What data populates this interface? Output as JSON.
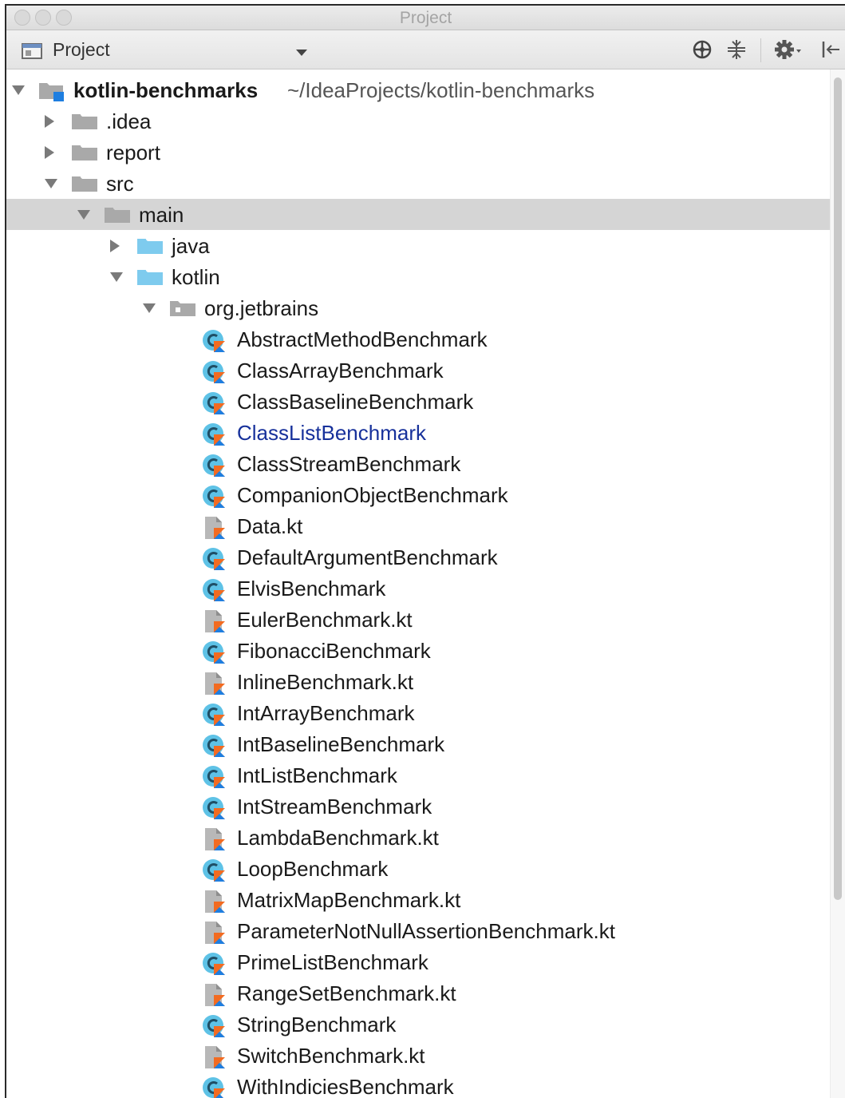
{
  "window": {
    "title": "Project",
    "traffic_lights": [
      "close",
      "minimize",
      "zoom"
    ],
    "light_color": "#d9d9d9"
  },
  "toolbar": {
    "view_label": "Project",
    "view_icon": "project-view-icon",
    "buttons": [
      "locate-icon",
      "collapse-all-icon",
      "settings-gear-icon",
      "hide-panel-icon"
    ]
  },
  "colors": {
    "selection": "#d5d5d5",
    "link": "#17319b",
    "folder_gray": "#a9a9a9",
    "folder_blue": "#7ecbee",
    "kotlin_orange": "#f26b21",
    "kotlin_blue": "#1e7ee0",
    "class_circle": "#5ec2e6"
  },
  "tree": {
    "root": {
      "name": "kotlin-benchmarks",
      "path": "~/IdeaProjects/kotlin-benchmarks"
    },
    "rows": [
      {
        "label": "kotlin-benchmarks",
        "depth": 0,
        "arrow": "down",
        "icon": "module",
        "bold": true,
        "path": "~/IdeaProjects/kotlin-benchmarks"
      },
      {
        "label": ".idea",
        "depth": 1,
        "arrow": "right",
        "icon": "folder"
      },
      {
        "label": "report",
        "depth": 1,
        "arrow": "right",
        "icon": "folder"
      },
      {
        "label": "src",
        "depth": 1,
        "arrow": "down",
        "icon": "folder"
      },
      {
        "label": "main",
        "depth": 2,
        "arrow": "down",
        "icon": "folder",
        "selected": true
      },
      {
        "label": "java",
        "depth": 3,
        "arrow": "right",
        "icon": "source-folder"
      },
      {
        "label": "kotlin",
        "depth": 3,
        "arrow": "down",
        "icon": "source-folder"
      },
      {
        "label": "org.jetbrains",
        "depth": 4,
        "arrow": "down",
        "icon": "package"
      },
      {
        "label": "AbstractMethodBenchmark",
        "depth": 5,
        "icon": "kotlin-class"
      },
      {
        "label": "ClassArrayBenchmark",
        "depth": 5,
        "icon": "kotlin-class"
      },
      {
        "label": "ClassBaselineBenchmark",
        "depth": 5,
        "icon": "kotlin-class"
      },
      {
        "label": "ClassListBenchmark",
        "depth": 5,
        "icon": "kotlin-class",
        "link": true
      },
      {
        "label": "ClassStreamBenchmark",
        "depth": 5,
        "icon": "kotlin-class"
      },
      {
        "label": "CompanionObjectBenchmark",
        "depth": 5,
        "icon": "kotlin-class"
      },
      {
        "label": "Data.kt",
        "depth": 5,
        "icon": "kotlin-file"
      },
      {
        "label": "DefaultArgumentBenchmark",
        "depth": 5,
        "icon": "kotlin-class"
      },
      {
        "label": "ElvisBenchmark",
        "depth": 5,
        "icon": "kotlin-class"
      },
      {
        "label": "EulerBenchmark.kt",
        "depth": 5,
        "icon": "kotlin-file"
      },
      {
        "label": "FibonacciBenchmark",
        "depth": 5,
        "icon": "kotlin-class"
      },
      {
        "label": "InlineBenchmark.kt",
        "depth": 5,
        "icon": "kotlin-file"
      },
      {
        "label": "IntArrayBenchmark",
        "depth": 5,
        "icon": "kotlin-class"
      },
      {
        "label": "IntBaselineBenchmark",
        "depth": 5,
        "icon": "kotlin-class"
      },
      {
        "label": "IntListBenchmark",
        "depth": 5,
        "icon": "kotlin-class"
      },
      {
        "label": "IntStreamBenchmark",
        "depth": 5,
        "icon": "kotlin-class"
      },
      {
        "label": "LambdaBenchmark.kt",
        "depth": 5,
        "icon": "kotlin-file"
      },
      {
        "label": "LoopBenchmark",
        "depth": 5,
        "icon": "kotlin-class"
      },
      {
        "label": "MatrixMapBenchmark.kt",
        "depth": 5,
        "icon": "kotlin-file"
      },
      {
        "label": "ParameterNotNullAssertionBenchmark.kt",
        "depth": 5,
        "icon": "kotlin-file"
      },
      {
        "label": "PrimeListBenchmark",
        "depth": 5,
        "icon": "kotlin-class"
      },
      {
        "label": "RangeSetBenchmark.kt",
        "depth": 5,
        "icon": "kotlin-file"
      },
      {
        "label": "StringBenchmark",
        "depth": 5,
        "icon": "kotlin-class"
      },
      {
        "label": "SwitchBenchmark.kt",
        "depth": 5,
        "icon": "kotlin-file"
      },
      {
        "label": "WithIndiciesBenchmark",
        "depth": 5,
        "icon": "kotlin-class"
      }
    ]
  }
}
